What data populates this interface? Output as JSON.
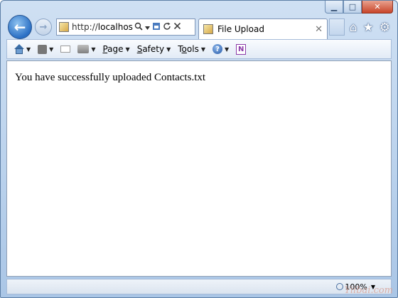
{
  "window": {
    "caption": {
      "minimize": "▁",
      "maximize": "□",
      "close": "✕"
    }
  },
  "nav": {
    "back_glyph": "←",
    "forward_glyph": "→",
    "address_scheme": "http://",
    "address_host": "localhost:",
    "address_icons": [
      "search-icon",
      "dropdown-icon",
      "compatibility-icon",
      "refresh-icon",
      "stop-icon"
    ]
  },
  "tab": {
    "title": "File Upload",
    "close": "✕"
  },
  "toolbar_right_icons": {
    "home": "⌂",
    "favorites": "★",
    "tools": "⚙"
  },
  "command_bar": {
    "page": {
      "u": "P",
      "rest": "age"
    },
    "safety": {
      "u": "S",
      "rest": "afety"
    },
    "tools": {
      "pre": "T",
      "u": "o",
      "rest": "ols"
    },
    "help_glyph": "?",
    "onenote_glyph": "N"
  },
  "content": {
    "message": "You have successfully uploaded Contacts.txt"
  },
  "status_bar": {
    "zoom": "100%"
  },
  "watermark": "Yiibai.com",
  "colors": {
    "frame": "#b9d1ec",
    "back_button": "#2a6fc4",
    "content_bg": "#ffffff"
  }
}
